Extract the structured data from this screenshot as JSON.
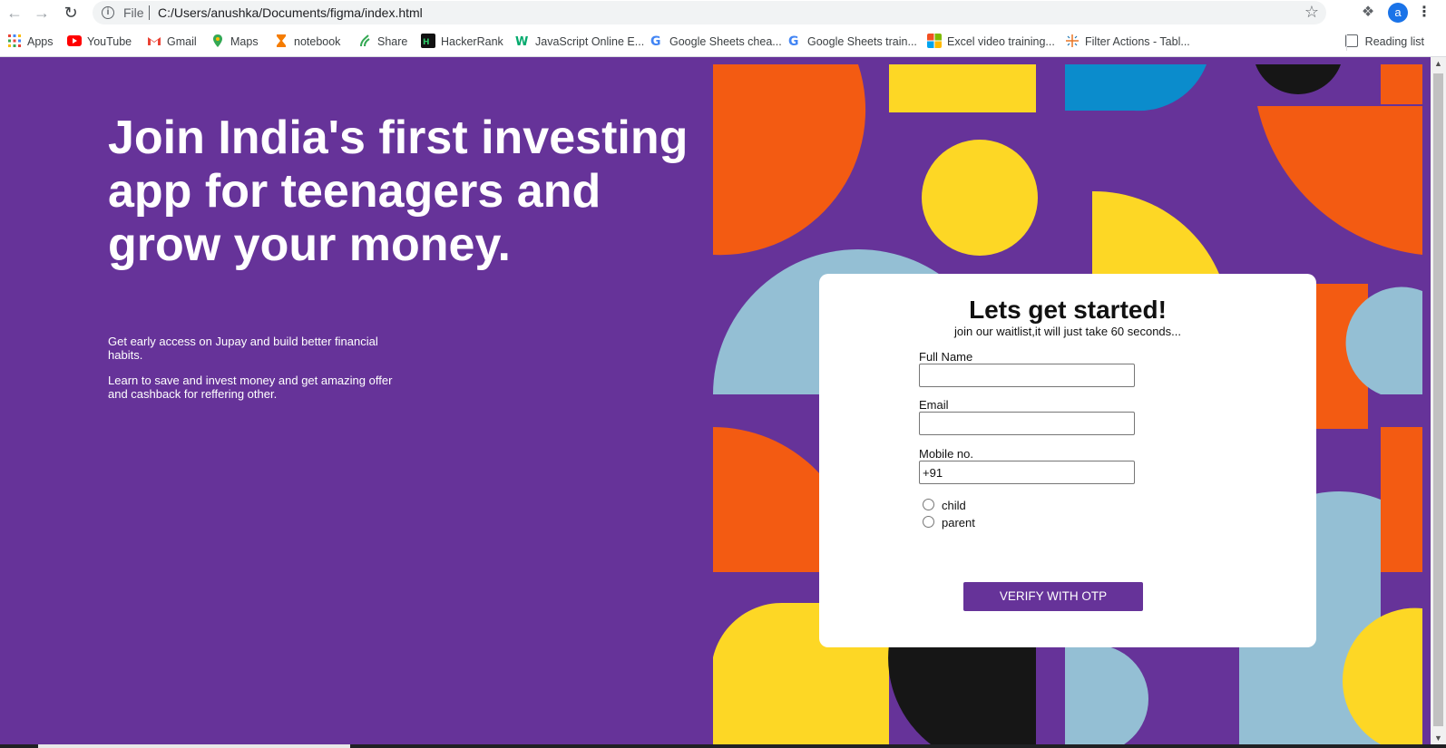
{
  "browser": {
    "file_label": "File",
    "url": "C:/Users/anushka/Documents/figma/index.html",
    "avatar_letter": "a",
    "bookmarks": [
      {
        "label": "Apps",
        "icon": "apps-grid-icon",
        "color": "#ea4335"
      },
      {
        "label": "YouTube",
        "icon": "youtube-icon",
        "color": "#ff0000"
      },
      {
        "label": "Gmail",
        "icon": "gmail-icon",
        "color": "#ea4335"
      },
      {
        "label": "Maps",
        "icon": "maps-icon",
        "color": "#34a853"
      },
      {
        "label": "notebook",
        "icon": "notebook-icon",
        "color": "#f57c00"
      },
      {
        "label": "Share",
        "icon": "share-icon",
        "color": "#34a853"
      },
      {
        "label": "HackerRank",
        "icon": "hackerrank-icon",
        "color": "#111111"
      },
      {
        "label": "JavaScript Online E...",
        "icon": "w3-icon",
        "color": "#04aa6d"
      },
      {
        "label": "Google Sheets chea...",
        "icon": "google-icon",
        "color": "#4285f4"
      },
      {
        "label": "Google Sheets train...",
        "icon": "google-icon",
        "color": "#4285f4"
      },
      {
        "label": "Excel video training...",
        "icon": "microsoft-icon",
        "color": "#f25022"
      },
      {
        "label": "Filter Actions - Tabl...",
        "icon": "tableau-icon",
        "color": "#e97627"
      }
    ],
    "reading_list": "Reading list"
  },
  "hero": {
    "headline": "Join India's first investing app for teenagers and grow your money.",
    "para1": "Get early access on Jupay and build better financial habits.",
    "para2": "Learn to save and invest money and get amazing offer and cashback for reffering other."
  },
  "form": {
    "title": "Lets get started!",
    "subtitle": "join our waitlist,it will just take 60 seconds...",
    "full_name_label": "Full Name",
    "full_name_value": "",
    "email_label": "Email",
    "email_value": "",
    "mobile_label": "Mobile no.",
    "mobile_value": "+91",
    "radio_child": "child",
    "radio_parent": "parent",
    "verify_button": "VERIFY WITH OTP"
  },
  "colors": {
    "page_bg": "#663399",
    "orange": "#f35b12",
    "yellow": "#fdd725",
    "blue": "#0b8ccc",
    "light_blue": "#94bfd4",
    "black": "#161616"
  }
}
